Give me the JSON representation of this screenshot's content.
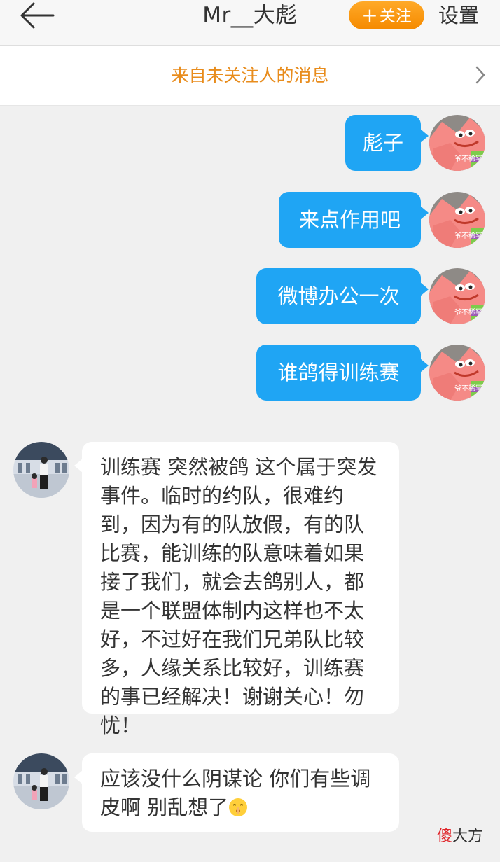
{
  "header": {
    "title": "Mr__大彪",
    "follow_label": "关注",
    "follow_plus": "+",
    "settings_label": "设置",
    "back_icon": "back-arrow-icon"
  },
  "notice": {
    "text": "来自未关注人的消息",
    "chevron_icon": "chevron-right-icon"
  },
  "sent_messages": [
    {
      "text": "彪子",
      "avatar_caption": "爷不稀罕"
    },
    {
      "text": "来点作用吧",
      "avatar_caption": "爷不稀罕"
    },
    {
      "text": "微博办公一次",
      "avatar_caption": "爷不稀罕"
    },
    {
      "text": "谁鸽得训练赛",
      "avatar_caption": "爷不稀罕"
    }
  ],
  "received_messages": [
    {
      "text": "训练赛 突然被鸽 这个属于突发事件。临时的约队，很难约到，因为有的队放假，有的队比赛，能训练的队意味着如果接了我们，就会去鸽别人，都是一个联盟体制内这样也不太好，不过好在我们兄弟队比较多，人缘关系比较好，训练赛的事已经解决！谢谢关心！勿忧！"
    },
    {
      "text": "应该没什么阴谋论 你们有些调皮啊 别乱想了",
      "emoji": "shushing-face-emoji"
    }
  ],
  "watermark": {
    "part1": "傻",
    "part2": "大方"
  },
  "colors": {
    "accent_orange": "#f58a00",
    "notice_text": "#e88c1c",
    "sent_bubble": "#1fa5f4",
    "received_bubble": "#ffffff",
    "background": "#f0f0f0"
  }
}
